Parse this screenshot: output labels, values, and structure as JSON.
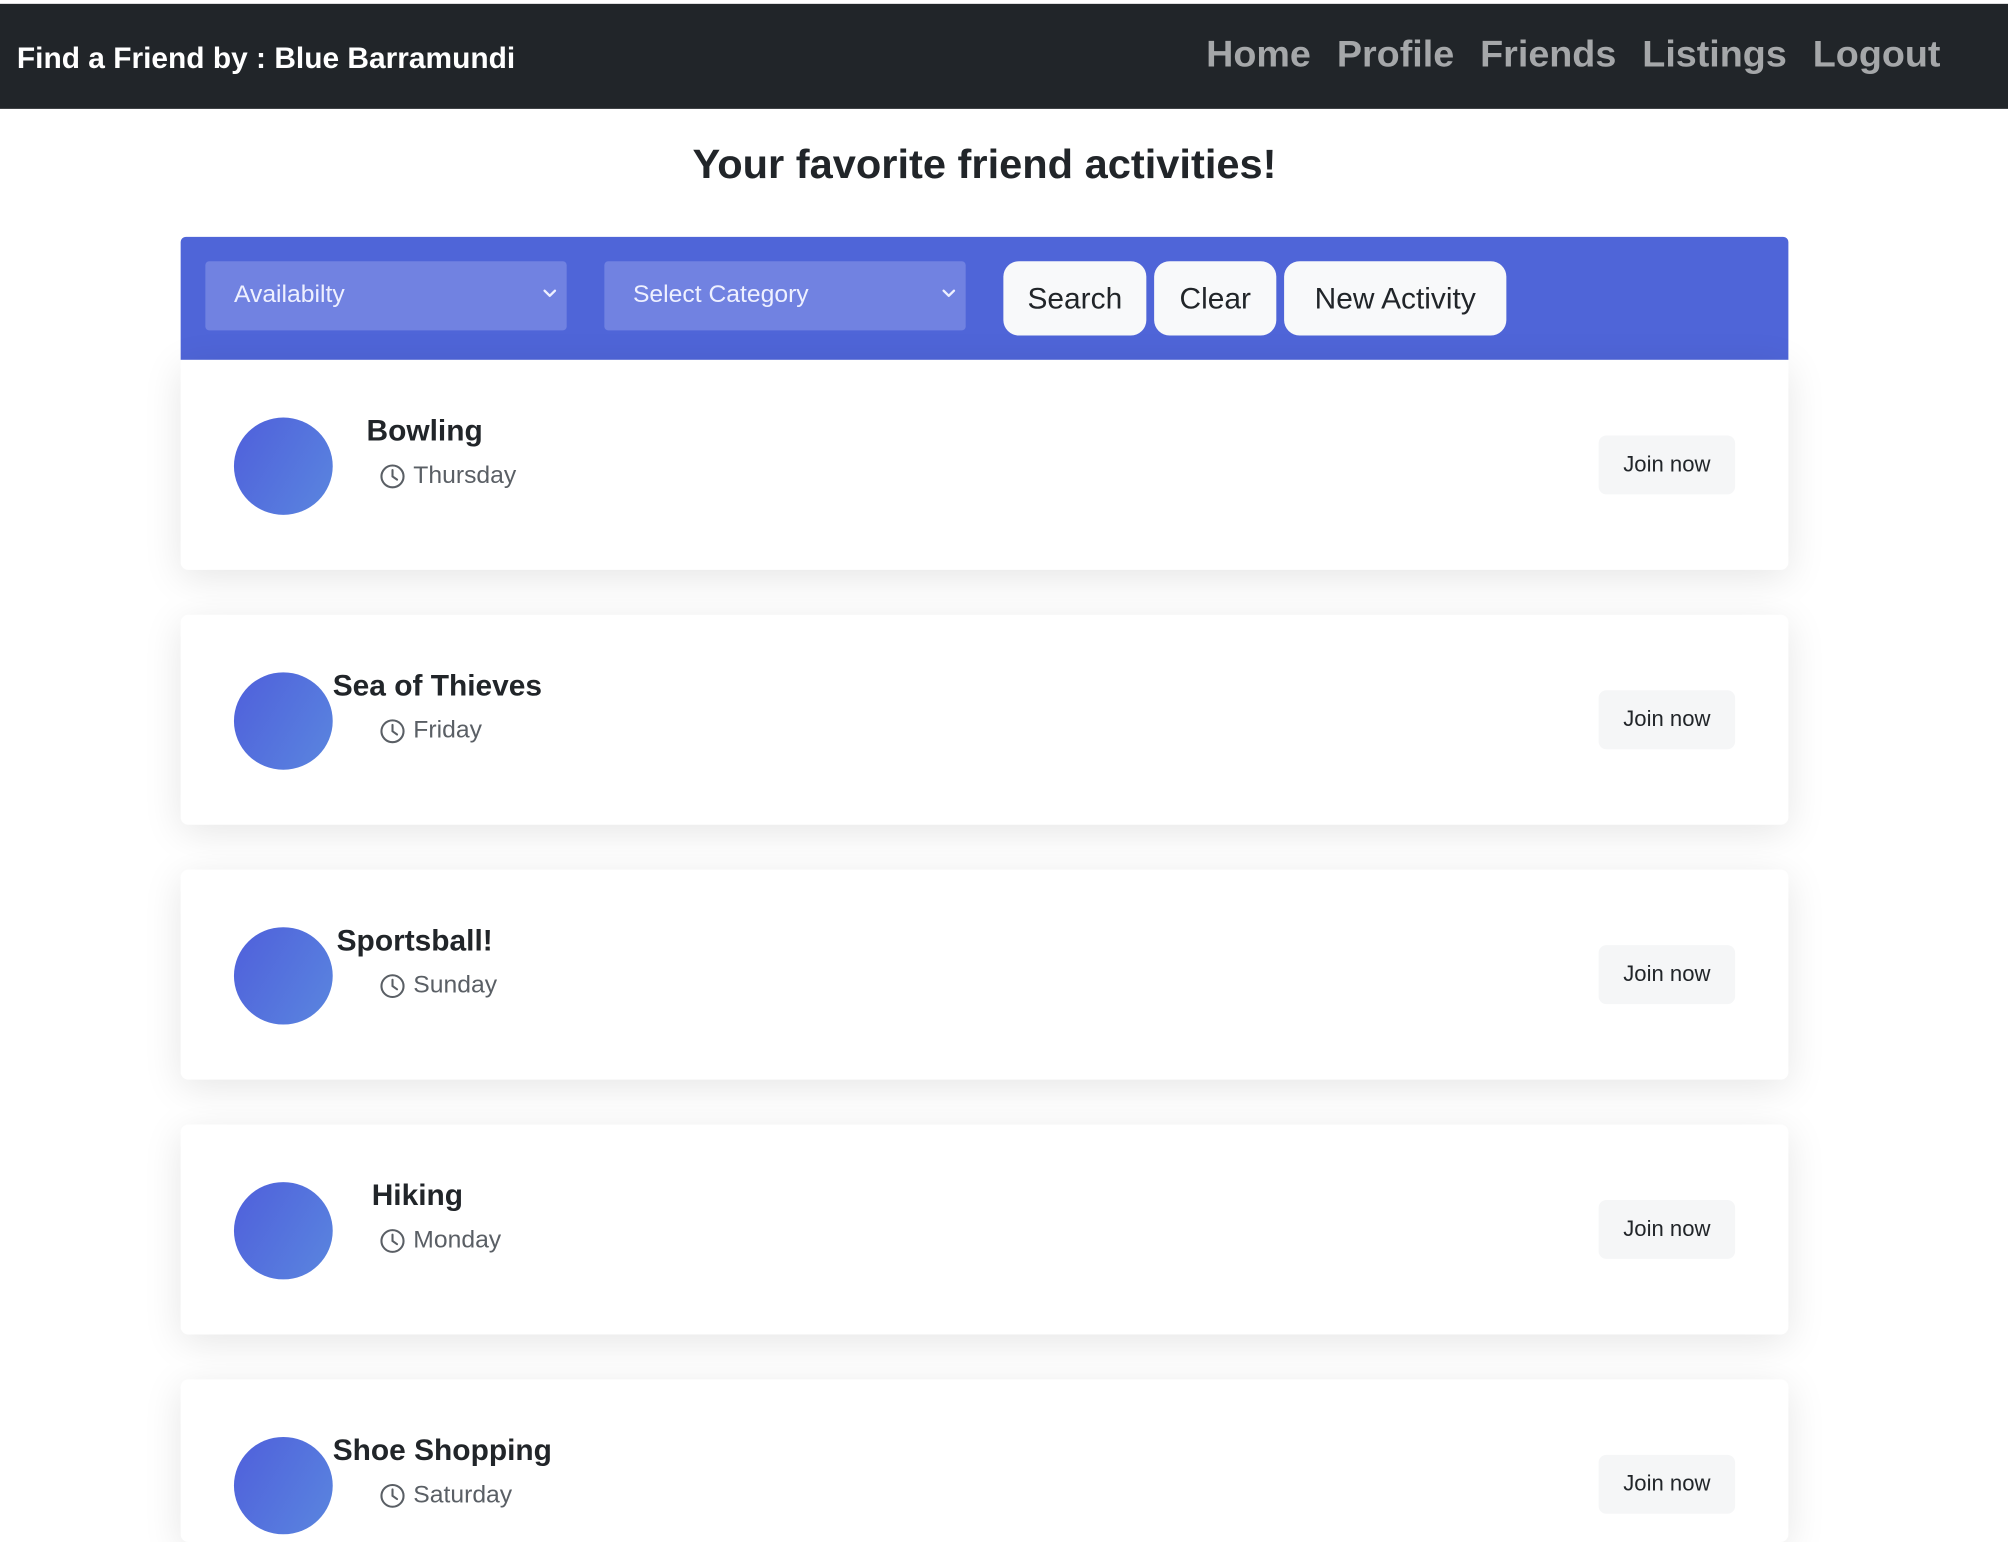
{
  "navbar": {
    "brand": "Find a Friend by : Blue Barramundi",
    "links": [
      "Home",
      "Profile",
      "Friends",
      "Listings",
      "Logout"
    ]
  },
  "page": {
    "heading": "Your favorite friend activities!"
  },
  "filters": {
    "availability": "Availabilty",
    "category": "Select Category",
    "search_label": "Search",
    "clear_label": "Clear",
    "new_activity_label": "New Activity"
  },
  "activities": [
    {
      "title": "Bowling",
      "day": "Thursday",
      "join": "Join now"
    },
    {
      "title": "Sea of Thieves",
      "day": "Friday",
      "join": "Join now"
    },
    {
      "title": "Sportsball!",
      "day": "Sunday",
      "join": "Join now"
    },
    {
      "title": "Hiking",
      "day": "Monday",
      "join": "Join now"
    },
    {
      "title": "Shoe Shopping",
      "day": "Saturday",
      "join": "Join now"
    }
  ],
  "colors": {
    "navbar_bg": "#212529",
    "filterbar_bg": "#4f65d8",
    "select_bg": "#7182e1",
    "avatar_start": "#4f5fdb",
    "avatar_end": "#5a86df"
  },
  "icons": {
    "time": "clock-icon",
    "dropdown": "chevron-down-icon"
  }
}
